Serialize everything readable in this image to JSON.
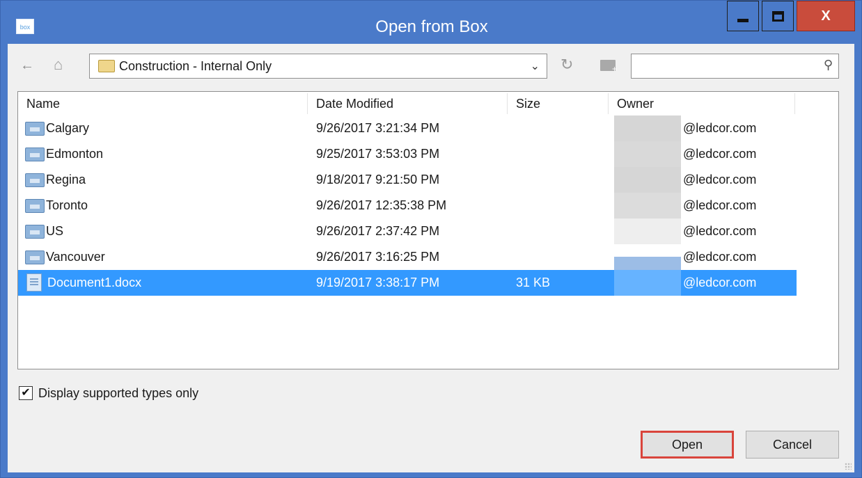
{
  "window": {
    "title": "Open from Box",
    "app_icon_text": "box",
    "close_label": "X"
  },
  "toolbar": {
    "path": "Construction - Internal Only",
    "search_value": "",
    "search_placeholder": ""
  },
  "columns": [
    "Name",
    "Date Modified",
    "Size",
    "Owner"
  ],
  "rows": [
    {
      "name": "Calgary",
      "date": "9/26/2017 3:21:34 PM",
      "size": "",
      "owner": "@ledcor.com",
      "type": "folder-icon"
    },
    {
      "name": "Edmonton",
      "date": "9/25/2017 3:53:03 PM",
      "size": "",
      "owner": "@ledcor.com",
      "type": "folder-icon"
    },
    {
      "name": "Regina",
      "date": "9/18/2017 9:21:50 PM",
      "size": "",
      "owner": "@ledcor.com",
      "type": "folder-icon"
    },
    {
      "name": "Toronto",
      "date": "9/26/2017 12:35:38 PM",
      "size": "",
      "owner": "@ledcor.com",
      "type": "folder-icon"
    },
    {
      "name": "US",
      "date": "9/26/2017 2:37:42 PM",
      "size": "",
      "owner": "@ledcor.com",
      "type": "folder-icon"
    },
    {
      "name": "Vancouver",
      "date": "9/26/2017 3:16:25 PM",
      "size": "",
      "owner": "@ledcor.com",
      "type": "folder-icon"
    },
    {
      "name": "Document1.docx",
      "date": "9/19/2017 3:38:17 PM",
      "size": "31 KB",
      "owner": "@ledcor.com",
      "type": "document-icon",
      "selected": true
    }
  ],
  "filter": {
    "label": "Display supported types only",
    "checked": true,
    "check_glyph": "✔"
  },
  "buttons": {
    "open_label": "Open",
    "cancel_label": "Cancel"
  },
  "colors": {
    "titlebar": "#4a7ac9",
    "close": "#c94c3c",
    "selection": "#3399ff",
    "open_highlight": "#d9443b"
  }
}
